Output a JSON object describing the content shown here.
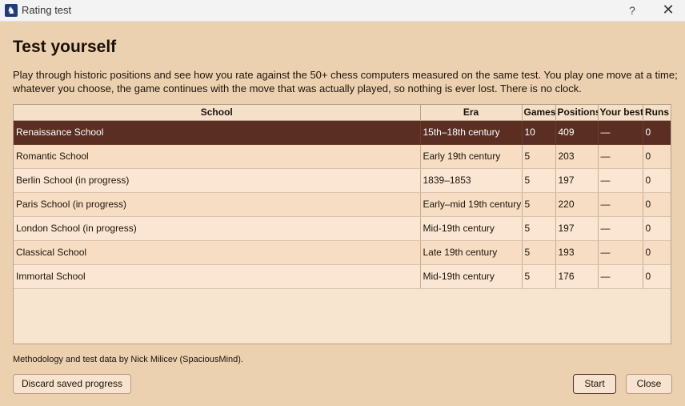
{
  "window": {
    "title": "Rating test",
    "help_label": "?",
    "close_label": "✕",
    "icon": "knight-icon"
  },
  "heading": "Test yourself",
  "intro": "Play through historic positions and see how you rate against the 50+ chess computers measured on the same test. You play one move at a time; whatever you choose, the game continues with the move that was actually played, so nothing is ever lost. There is no clock.",
  "table": {
    "columns": [
      "School",
      "Era",
      "Games",
      "Positions",
      "Your best",
      "Runs"
    ],
    "rows": [
      {
        "school": "Renaissance School",
        "era": "15th–18th century",
        "games": "10",
        "positions": "409",
        "best": "—",
        "runs": "0",
        "selected": true
      },
      {
        "school": "Romantic School",
        "era": "Early 19th century",
        "games": "5",
        "positions": "203",
        "best": "—",
        "runs": "0"
      },
      {
        "school": "Berlin School   (in progress)",
        "era": "1839–1853",
        "games": "5",
        "positions": "197",
        "best": "—",
        "runs": "0"
      },
      {
        "school": "Paris School   (in progress)",
        "era": "Early–mid 19th century",
        "games": "5",
        "positions": "220",
        "best": "—",
        "runs": "0"
      },
      {
        "school": "London School   (in progress)",
        "era": "Mid-19th century",
        "games": "5",
        "positions": "197",
        "best": "—",
        "runs": "0"
      },
      {
        "school": "Classical School",
        "era": "Late 19th century",
        "games": "5",
        "positions": "193",
        "best": "—",
        "runs": "0"
      },
      {
        "school": "Immortal School",
        "era": "Mid-19th century",
        "games": "5",
        "positions": "176",
        "best": "—",
        "runs": "0"
      }
    ]
  },
  "credit": "Methodology and test data by Nick Milicev (SpaciousMind).",
  "buttons": {
    "discard": "Discard saved progress",
    "start": "Start",
    "close": "Close"
  },
  "colors": {
    "background": "#ecd1b1",
    "selected_row": "#5a2e22"
  }
}
